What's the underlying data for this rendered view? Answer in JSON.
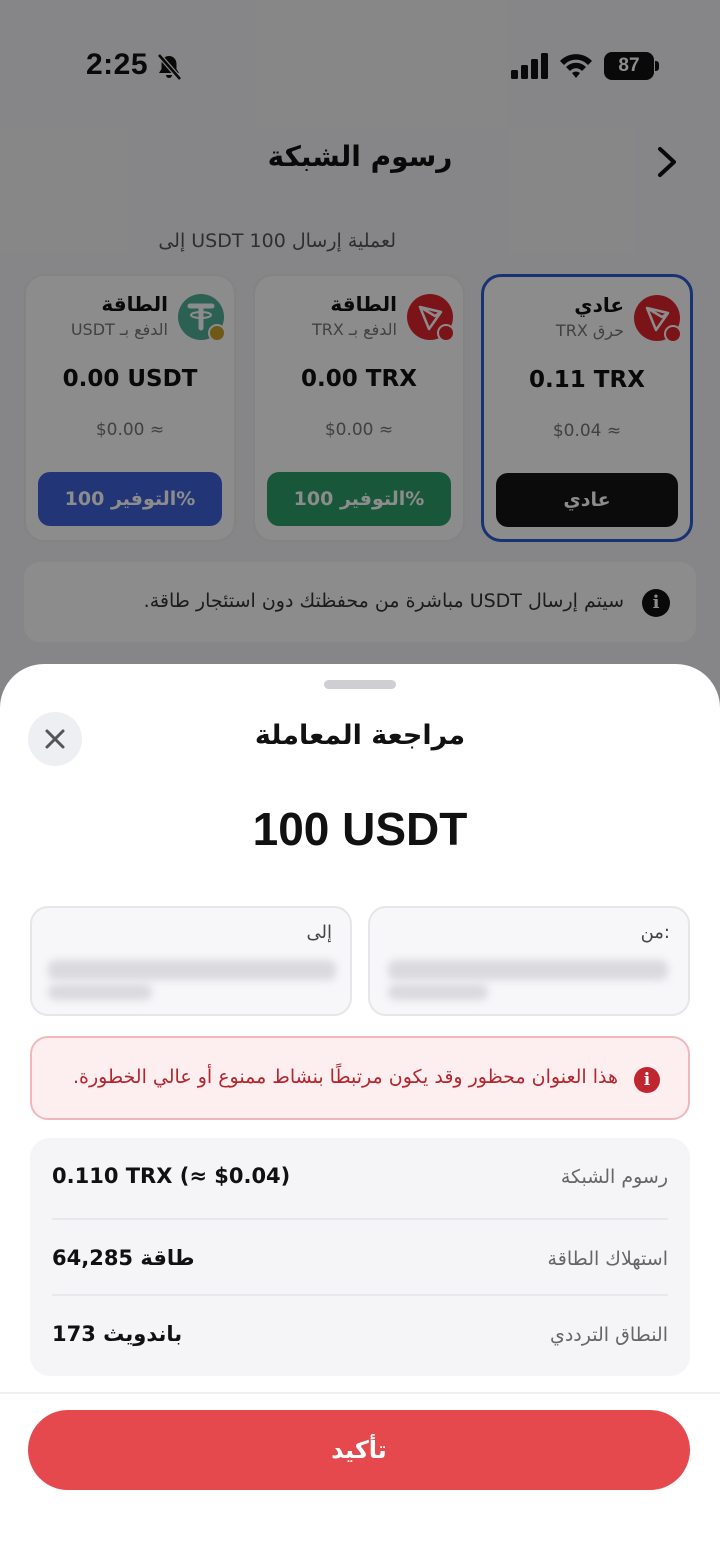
{
  "status_bar": {
    "time": "2:25",
    "battery": "87"
  },
  "header": {
    "title": "رسوم الشبكة"
  },
  "subtitle": "لعملية إرسال 100 USDT إلى",
  "fee_cards": [
    {
      "name": "عادي",
      "sub": "حرق TRX",
      "amount": "0.11 TRX",
      "usd": "$0.04 ≈",
      "button": "عادي",
      "selected": true,
      "button_color": "#151515",
      "icon": "tron-icon"
    },
    {
      "name": "الطاقة",
      "sub": "الدفع بـ TRX",
      "amount": "0.00 TRX",
      "usd": "$0.00 ≈",
      "button": "التوفير 100%",
      "selected": false,
      "button_color": "#2f9e6a",
      "icon": "tron-icon"
    },
    {
      "name": "الطاقة",
      "sub": "الدفع بـ USDT",
      "amount": "0.00 USDT",
      "usd": "$0.00 ≈",
      "button": "التوفير 100%",
      "selected": false,
      "button_color": "#3f63d9",
      "icon": "tether-icon"
    }
  ],
  "info_text": "سيتم إرسال USDT مباشرة من محفظتك دون استئجار طاقة.",
  "sheet": {
    "title": "مراجعة المعاملة",
    "amount": "100 USDT",
    "from_label": "من:",
    "to_label": "إلى",
    "warning": "هذا العنوان محظور وقد يكون مرتبطًا بنشاط ممنوع أو عالي الخطورة.",
    "details": [
      {
        "label": "رسوم الشبكة",
        "value": "0.110 TRX (≈ $0.04)"
      },
      {
        "label": "استهلاك الطاقة",
        "value": "64,285 طاقة"
      },
      {
        "label": "النطاق الترددي",
        "value": "173 باندويث"
      }
    ],
    "confirm": "تأكيد"
  },
  "colors": {
    "accent_red": "#e5484d",
    "selected_border": "#2f5bd3",
    "tron_red": "#e0262d",
    "tether_green": "#50af95"
  }
}
